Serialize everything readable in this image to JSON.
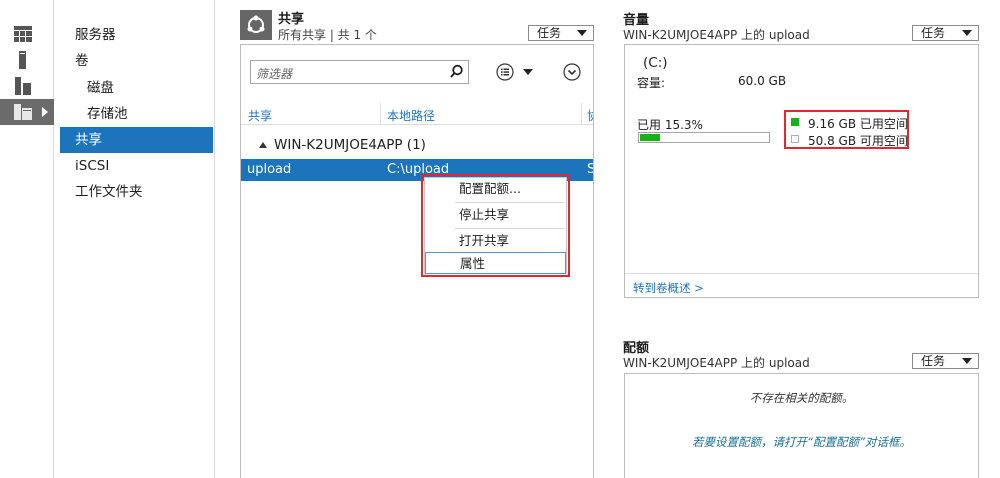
{
  "nav": {
    "items": [
      {
        "label": "服务器"
      },
      {
        "label": "卷"
      },
      {
        "label": "磁盘"
      },
      {
        "label": "存储池"
      },
      {
        "label": "共享"
      },
      {
        "label": "iSCSI"
      },
      {
        "label": "工作文件夹"
      }
    ]
  },
  "rail": {
    "icons": [
      "dashboard-icon",
      "server-icon",
      "roles-icon",
      "file-services-icon"
    ]
  },
  "shares": {
    "title": "共享",
    "subtitle": "所有共享 | 共 1 个",
    "tasks_label": "任务",
    "filter_placeholder": "筛选器",
    "columns": [
      "共享",
      "本地路径",
      "协"
    ],
    "group_label": "WIN-K2UMJOE4APP (1)",
    "rows": [
      {
        "share": "upload",
        "path": "C:\\upload",
        "protocol": "S"
      }
    ]
  },
  "context_menu": {
    "items": [
      "配置配额...",
      "停止共享",
      "打开共享",
      "属性"
    ]
  },
  "volume": {
    "title": "音量",
    "subtitle": "WIN-K2UMJOE4APP 上的 upload",
    "tasks_label": "任务",
    "drive": "(C:)",
    "capacity_label": "容量:",
    "capacity_value": "60.0 GB",
    "used_label": "已用 15.3%",
    "used_fraction": 0.153,
    "legend_used": "9.16 GB 已用空间",
    "legend_free": "50.8 GB 可用空间",
    "used_color": "#16b316",
    "link": "转到卷概述 >"
  },
  "quota": {
    "title": "配额",
    "subtitle": "WIN-K2UMJOE4APP 上的 upload",
    "tasks_label": "任务",
    "empty_text": "不存在相关的配额。",
    "hint_text": "若要设置配额，请打开“配置配额”对话框。"
  }
}
